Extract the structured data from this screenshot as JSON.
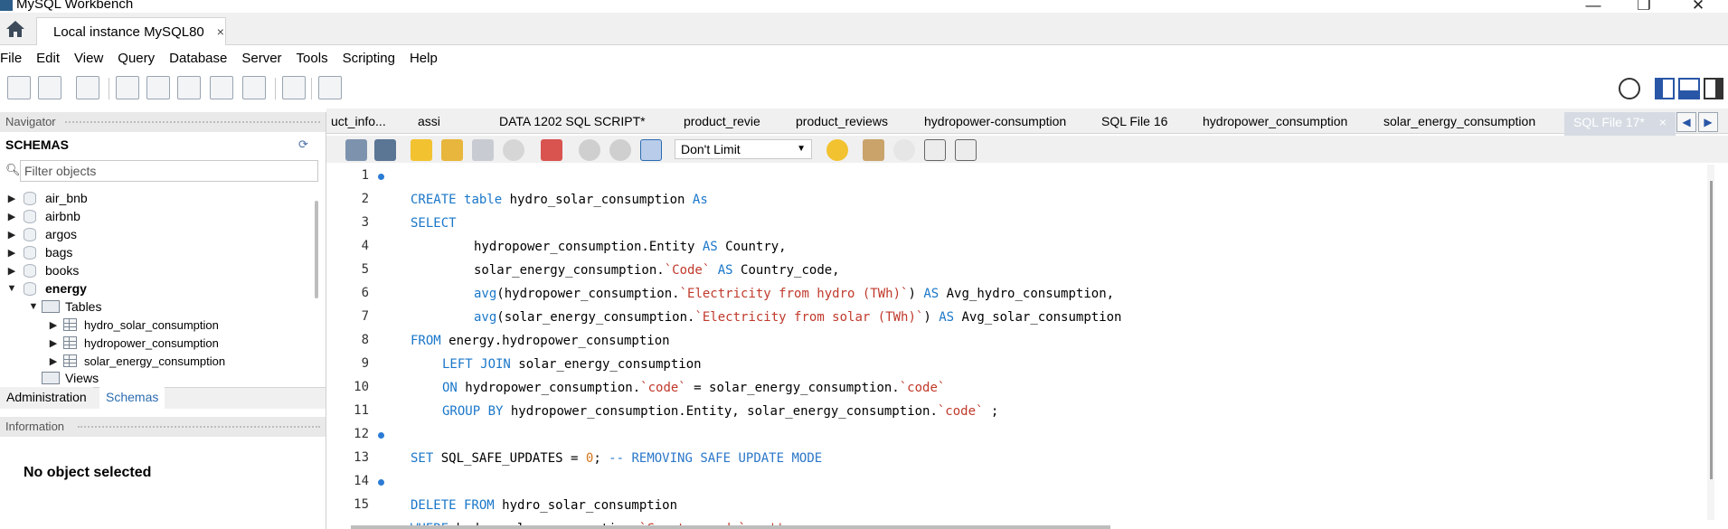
{
  "window": {
    "title": "MySQL Workbench",
    "controls": {
      "minimize": "—",
      "maximize": "❐",
      "close": "✕"
    }
  },
  "connection_tab": {
    "label": "Local instance MySQL80",
    "close": "×"
  },
  "menu": [
    "File",
    "Edit",
    "View",
    "Query",
    "Database",
    "Server",
    "Tools",
    "Scripting",
    "Help"
  ],
  "navigator": {
    "header": "Navigator",
    "schemas_label": "SCHEMAS",
    "filter_placeholder": "Filter objects",
    "tree": [
      {
        "label": "air_bnb",
        "expanded": false
      },
      {
        "label": "airbnb",
        "expanded": false
      },
      {
        "label": "argos",
        "expanded": false
      },
      {
        "label": "bags",
        "expanded": false
      },
      {
        "label": "books",
        "expanded": false
      },
      {
        "label": "energy",
        "expanded": true,
        "bold": true
      }
    ],
    "tables_label": "Tables",
    "tables": [
      "hydro_solar_consumption",
      "hydropower_consumption",
      "solar_energy_consumption"
    ],
    "views_label": "Views",
    "bottom_tabs": [
      "Administration",
      "Schemas"
    ],
    "info_header": "Information",
    "no_object": "No object selected"
  },
  "editor_tabs": [
    "uct_info...",
    "assi",
    "DATA 1202 SQL SCRIPT*",
    "product_revie",
    "product_reviews",
    "hydropower-consumption",
    "SQL File 16",
    "hydropower_consumption",
    "solar_energy_consumption",
    "SQL File 17*"
  ],
  "editor_toolbar": {
    "limit": "Don't Limit"
  },
  "code_lines": [
    {
      "n": "1",
      "dot": true
    },
    {
      "n": "2",
      "dot": false
    },
    {
      "n": "3",
      "dot": false
    },
    {
      "n": "4",
      "dot": false
    },
    {
      "n": "5",
      "dot": false
    },
    {
      "n": "6",
      "dot": false
    },
    {
      "n": "7",
      "dot": false
    },
    {
      "n": "8",
      "dot": false
    },
    {
      "n": "9",
      "dot": false
    },
    {
      "n": "10",
      "dot": false
    },
    {
      "n": "11",
      "dot": false
    },
    {
      "n": "12",
      "dot": true
    },
    {
      "n": "13",
      "dot": false
    },
    {
      "n": "14",
      "dot": true
    },
    {
      "n": "15",
      "dot": false
    }
  ],
  "code": {
    "l1_kw1": "CREATE",
    "l1_kw2": "table",
    "l1_name": "hydro_solar_consumption",
    "l1_kw3": "As",
    "l2_kw": "SELECT",
    "l3_text": "hydropower_consumption.Entity ",
    "l3_kw": "AS",
    "l3_alias": "Country,",
    "l4_text": "solar_energy_consumption.",
    "l4_col": "`Code`",
    "l4_kw": "AS",
    "l4_alias": "Country_code,",
    "l5_fn": "avg",
    "l5_text": "(hydropower_consumption.",
    "l5_col": "`Electricity from hydro (TWh)`",
    "l5_close": ") ",
    "l5_kw": "AS",
    "l5_alias": " Avg_hydro_consumption,",
    "l6_fn": "avg",
    "l6_text": "(solar_energy_consumption.",
    "l6_col": "`Electricity from solar (TWh)`",
    "l6_close": ") ",
    "l6_kw": "AS",
    "l6_alias": " Avg_solar_consumption",
    "l7_kw": "FROM",
    "l7_text": " energy.hydropower_consumption",
    "l8_kw": "LEFT JOIN",
    "l8_text": " solar_energy_consumption",
    "l9_kw": "ON",
    "l9_text1": " hydropower_consumption.",
    "l9_col1": "`code`",
    "l9_text2": " = solar_energy_consumption.",
    "l9_col2": "`code`",
    "l10_kw": "GROUP BY",
    "l10_text1": " hydropower_consumption.Entity, solar_energy_consumption.",
    "l10_col": "`code`",
    "l10_text2": " ;",
    "l12_kw": "SET",
    "l12_text": " SQL_SAFE_UPDATES = ",
    "l12_num": "0",
    "l12_semi": "; ",
    "l12_cmt": "-- REMOVING SAFE UPDATE MODE",
    "l14_kw": "DELETE FROM",
    "l14_text": " hydro_solar_consumption",
    "l15_kw": "WHERE",
    "l15_text": " hydro_solar_consumption.",
    "l15_col": "`Country_code`",
    "l15_eq": " = ",
    "l15_str": "''",
    "l15_semi": ";"
  },
  "colors": {
    "keyword": "#1a77c9",
    "string": "#c0392b",
    "number": "#d4741a",
    "active_tab": "#d6dbe3"
  }
}
